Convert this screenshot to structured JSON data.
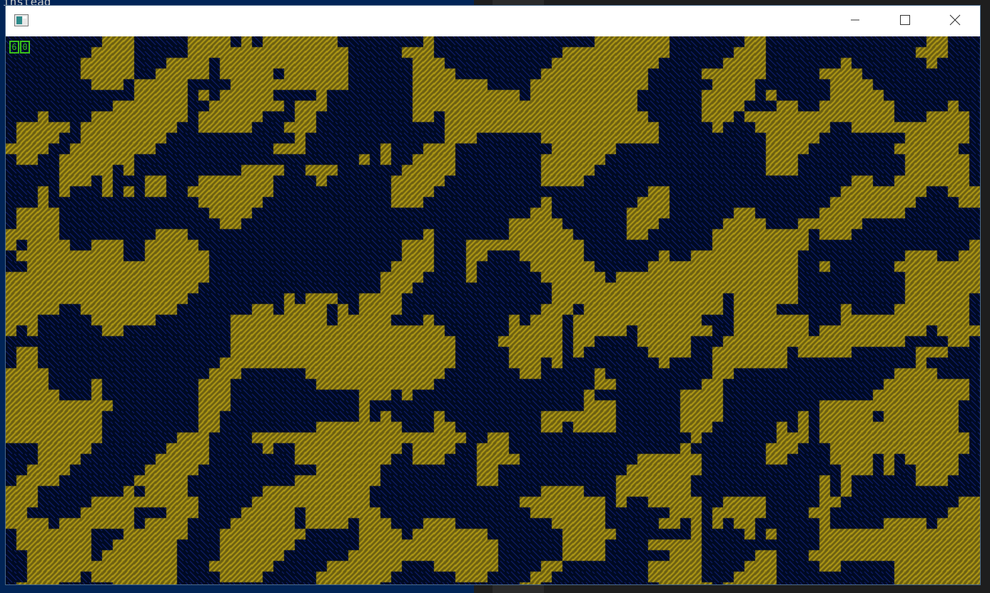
{
  "background": {
    "terminal_text": "instead"
  },
  "window": {
    "title": "",
    "icon": "app-window-icon",
    "controls": {
      "minimize": "minimize-icon",
      "maximize": "maximize-icon",
      "close": "close-icon"
    }
  },
  "game": {
    "fps_counter": "60",
    "colors": {
      "ground": "#6b5e12",
      "ground_stripe": "#b39d17",
      "dark": "#000a22",
      "dark_stripe": "#1a2a9a",
      "fps": "#3ac21a"
    },
    "tile_size": 15
  }
}
